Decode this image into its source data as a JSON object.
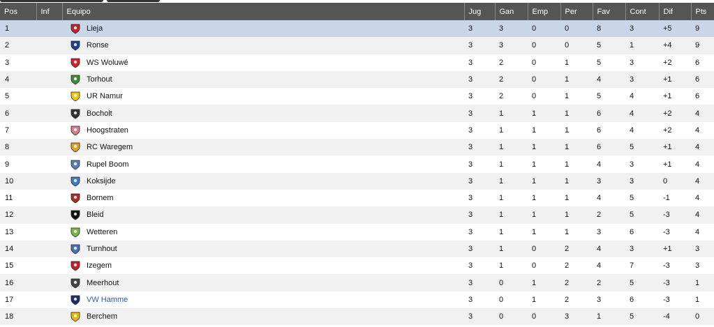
{
  "table": {
    "headers": [
      "Pos",
      "Inf",
      "Equipo",
      "Jug",
      "Gan",
      "Emp",
      "Per",
      "Fav",
      "Cont",
      "Dif",
      "Pts"
    ],
    "rows": [
      {
        "pos": "1",
        "team": "Lieja",
        "logo": "lieja-crest-icon",
        "color": "#c0252c",
        "jug": "3",
        "gan": "3",
        "emp": "0",
        "per": "0",
        "fav": "8",
        "cont": "3",
        "dif": "+5",
        "pts": "9",
        "highlight": true
      },
      {
        "pos": "2",
        "team": "Ronse",
        "logo": "ronse-crest-icon",
        "color": "#1f3f8f",
        "jug": "3",
        "gan": "3",
        "emp": "0",
        "per": "0",
        "fav": "5",
        "cont": "1",
        "dif": "+4",
        "pts": "9"
      },
      {
        "pos": "3",
        "team": "WS Woluwé",
        "logo": "ws-woluwe-crest-icon",
        "color": "#d3232a",
        "jug": "3",
        "gan": "2",
        "emp": "0",
        "per": "1",
        "fav": "5",
        "cont": "3",
        "dif": "+2",
        "pts": "6"
      },
      {
        "pos": "4",
        "team": "Torhout",
        "logo": "torhout-crest-icon",
        "color": "#3f8a3a",
        "jug": "3",
        "gan": "2",
        "emp": "0",
        "per": "1",
        "fav": "4",
        "cont": "3",
        "dif": "+1",
        "pts": "6"
      },
      {
        "pos": "5",
        "team": "UR Namur",
        "logo": "ur-namur-crest-icon",
        "color": "#f2c500",
        "jug": "3",
        "gan": "2",
        "emp": "0",
        "per": "1",
        "fav": "5",
        "cont": "4",
        "dif": "+1",
        "pts": "6"
      },
      {
        "pos": "6",
        "team": "Bocholt",
        "logo": "bocholt-crest-icon",
        "color": "#333333",
        "jug": "3",
        "gan": "1",
        "emp": "1",
        "per": "1",
        "fav": "6",
        "cont": "4",
        "dif": "+2",
        "pts": "4"
      },
      {
        "pos": "7",
        "team": "Hoogstraten",
        "logo": "hoogstraten-crest-icon",
        "color": "#d97a8a",
        "jug": "3",
        "gan": "1",
        "emp": "1",
        "per": "1",
        "fav": "6",
        "cont": "4",
        "dif": "+2",
        "pts": "4"
      },
      {
        "pos": "8",
        "team": "RC Waregem",
        "logo": "rc-waregem-crest-icon",
        "color": "#e0a020",
        "jug": "3",
        "gan": "1",
        "emp": "1",
        "per": "1",
        "fav": "6",
        "cont": "5",
        "dif": "+1",
        "pts": "4"
      },
      {
        "pos": "9",
        "team": "Rupel Boom",
        "logo": "rupel-boom-crest-icon",
        "color": "#5a7fb8",
        "jug": "3",
        "gan": "1",
        "emp": "1",
        "per": "1",
        "fav": "4",
        "cont": "3",
        "dif": "+1",
        "pts": "4"
      },
      {
        "pos": "10",
        "team": "Koksijde",
        "logo": "koksijde-crest-icon",
        "color": "#3b7fc4",
        "jug": "3",
        "gan": "1",
        "emp": "1",
        "per": "1",
        "fav": "3",
        "cont": "3",
        "dif": "0",
        "pts": "4"
      },
      {
        "pos": "11",
        "team": "Bornem",
        "logo": "bornem-crest-icon",
        "color": "#b02a2a",
        "jug": "3",
        "gan": "1",
        "emp": "1",
        "per": "1",
        "fav": "4",
        "cont": "5",
        "dif": "-1",
        "pts": "4"
      },
      {
        "pos": "12",
        "team": "Bleid",
        "logo": "bleid-crest-icon",
        "color": "#111111",
        "jug": "3",
        "gan": "1",
        "emp": "1",
        "per": "1",
        "fav": "2",
        "cont": "5",
        "dif": "-3",
        "pts": "4"
      },
      {
        "pos": "13",
        "team": "Wetteren",
        "logo": "wetteren-crest-icon",
        "color": "#7ab648",
        "jug": "3",
        "gan": "1",
        "emp": "1",
        "per": "1",
        "fav": "3",
        "cont": "6",
        "dif": "-3",
        "pts": "4"
      },
      {
        "pos": "14",
        "team": "Turnhout",
        "logo": "turnhout-crest-icon",
        "color": "#4a6fb5",
        "jug": "3",
        "gan": "1",
        "emp": "0",
        "per": "2",
        "fav": "4",
        "cont": "3",
        "dif": "+1",
        "pts": "3"
      },
      {
        "pos": "15",
        "team": "Izegem",
        "logo": "izegem-crest-icon",
        "color": "#c8202a",
        "jug": "3",
        "gan": "1",
        "emp": "0",
        "per": "2",
        "fav": "4",
        "cont": "7",
        "dif": "-3",
        "pts": "3"
      },
      {
        "pos": "16",
        "team": "Meerhout",
        "logo": "meerhout-crest-icon",
        "color": "#444444",
        "jug": "3",
        "gan": "0",
        "emp": "1",
        "per": "2",
        "fav": "2",
        "cont": "5",
        "dif": "-3",
        "pts": "1"
      },
      {
        "pos": "17",
        "team": "VW Hamme",
        "logo": "vw-hamme-crest-icon",
        "color": "#1a2f6b",
        "jug": "3",
        "gan": "0",
        "emp": "1",
        "per": "2",
        "fav": "3",
        "cont": "6",
        "dif": "-3",
        "pts": "1",
        "link": true
      },
      {
        "pos": "18",
        "team": "Berchem",
        "logo": "berchem-crest-icon",
        "color": "#e6b800",
        "jug": "3",
        "gan": "0",
        "emp": "0",
        "per": "3",
        "fav": "1",
        "cont": "5",
        "dif": "-4",
        "pts": "0"
      }
    ]
  },
  "colors": {
    "header_bg": "#555555",
    "highlight_row": "#c9d5e8",
    "link": "#2a5db0"
  }
}
